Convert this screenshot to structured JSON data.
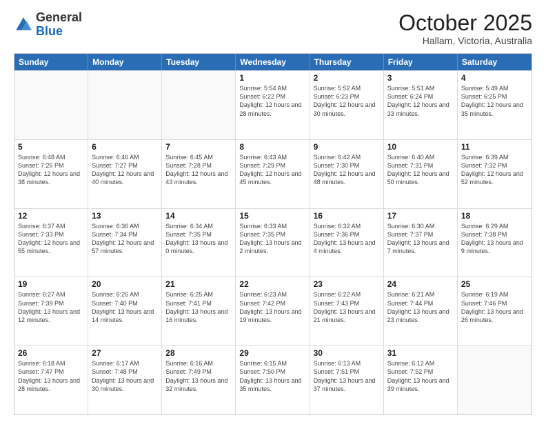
{
  "header": {
    "logo_general": "General",
    "logo_blue": "Blue",
    "month_title": "October 2025",
    "subtitle": "Hallam, Victoria, Australia"
  },
  "calendar": {
    "days_of_week": [
      "Sunday",
      "Monday",
      "Tuesday",
      "Wednesday",
      "Thursday",
      "Friday",
      "Saturday"
    ],
    "rows": [
      [
        {
          "day": "",
          "empty": true
        },
        {
          "day": "",
          "empty": true
        },
        {
          "day": "",
          "empty": true
        },
        {
          "day": "1",
          "sunrise": "Sunrise: 5:54 AM",
          "sunset": "Sunset: 6:22 PM",
          "daylight": "Daylight: 12 hours and 28 minutes."
        },
        {
          "day": "2",
          "sunrise": "Sunrise: 5:52 AM",
          "sunset": "Sunset: 6:23 PM",
          "daylight": "Daylight: 12 hours and 30 minutes."
        },
        {
          "day": "3",
          "sunrise": "Sunrise: 5:51 AM",
          "sunset": "Sunset: 6:24 PM",
          "daylight": "Daylight: 12 hours and 33 minutes."
        },
        {
          "day": "4",
          "sunrise": "Sunrise: 5:49 AM",
          "sunset": "Sunset: 6:25 PM",
          "daylight": "Daylight: 12 hours and 35 minutes."
        }
      ],
      [
        {
          "day": "5",
          "sunrise": "Sunrise: 6:48 AM",
          "sunset": "Sunset: 7:26 PM",
          "daylight": "Daylight: 12 hours and 38 minutes."
        },
        {
          "day": "6",
          "sunrise": "Sunrise: 6:46 AM",
          "sunset": "Sunset: 7:27 PM",
          "daylight": "Daylight: 12 hours and 40 minutes."
        },
        {
          "day": "7",
          "sunrise": "Sunrise: 6:45 AM",
          "sunset": "Sunset: 7:28 PM",
          "daylight": "Daylight: 12 hours and 43 minutes."
        },
        {
          "day": "8",
          "sunrise": "Sunrise: 6:43 AM",
          "sunset": "Sunset: 7:29 PM",
          "daylight": "Daylight: 12 hours and 45 minutes."
        },
        {
          "day": "9",
          "sunrise": "Sunrise: 6:42 AM",
          "sunset": "Sunset: 7:30 PM",
          "daylight": "Daylight: 12 hours and 48 minutes."
        },
        {
          "day": "10",
          "sunrise": "Sunrise: 6:40 AM",
          "sunset": "Sunset: 7:31 PM",
          "daylight": "Daylight: 12 hours and 50 minutes."
        },
        {
          "day": "11",
          "sunrise": "Sunrise: 6:39 AM",
          "sunset": "Sunset: 7:32 PM",
          "daylight": "Daylight: 12 hours and 52 minutes."
        }
      ],
      [
        {
          "day": "12",
          "sunrise": "Sunrise: 6:37 AM",
          "sunset": "Sunset: 7:33 PM",
          "daylight": "Daylight: 12 hours and 55 minutes."
        },
        {
          "day": "13",
          "sunrise": "Sunrise: 6:36 AM",
          "sunset": "Sunset: 7:34 PM",
          "daylight": "Daylight: 12 hours and 57 minutes."
        },
        {
          "day": "14",
          "sunrise": "Sunrise: 6:34 AM",
          "sunset": "Sunset: 7:35 PM",
          "daylight": "Daylight: 13 hours and 0 minutes."
        },
        {
          "day": "15",
          "sunrise": "Sunrise: 6:33 AM",
          "sunset": "Sunset: 7:35 PM",
          "daylight": "Daylight: 13 hours and 2 minutes."
        },
        {
          "day": "16",
          "sunrise": "Sunrise: 6:32 AM",
          "sunset": "Sunset: 7:36 PM",
          "daylight": "Daylight: 13 hours and 4 minutes."
        },
        {
          "day": "17",
          "sunrise": "Sunrise: 6:30 AM",
          "sunset": "Sunset: 7:37 PM",
          "daylight": "Daylight: 13 hours and 7 minutes."
        },
        {
          "day": "18",
          "sunrise": "Sunrise: 6:29 AM",
          "sunset": "Sunset: 7:38 PM",
          "daylight": "Daylight: 13 hours and 9 minutes."
        }
      ],
      [
        {
          "day": "19",
          "sunrise": "Sunrise: 6:27 AM",
          "sunset": "Sunset: 7:39 PM",
          "daylight": "Daylight: 13 hours and 12 minutes."
        },
        {
          "day": "20",
          "sunrise": "Sunrise: 6:26 AM",
          "sunset": "Sunset: 7:40 PM",
          "daylight": "Daylight: 13 hours and 14 minutes."
        },
        {
          "day": "21",
          "sunrise": "Sunrise: 6:25 AM",
          "sunset": "Sunset: 7:41 PM",
          "daylight": "Daylight: 13 hours and 16 minutes."
        },
        {
          "day": "22",
          "sunrise": "Sunrise: 6:23 AM",
          "sunset": "Sunset: 7:42 PM",
          "daylight": "Daylight: 13 hours and 19 minutes."
        },
        {
          "day": "23",
          "sunrise": "Sunrise: 6:22 AM",
          "sunset": "Sunset: 7:43 PM",
          "daylight": "Daylight: 13 hours and 21 minutes."
        },
        {
          "day": "24",
          "sunrise": "Sunrise: 6:21 AM",
          "sunset": "Sunset: 7:44 PM",
          "daylight": "Daylight: 13 hours and 23 minutes."
        },
        {
          "day": "25",
          "sunrise": "Sunrise: 6:19 AM",
          "sunset": "Sunset: 7:46 PM",
          "daylight": "Daylight: 13 hours and 26 minutes."
        }
      ],
      [
        {
          "day": "26",
          "sunrise": "Sunrise: 6:18 AM",
          "sunset": "Sunset: 7:47 PM",
          "daylight": "Daylight: 13 hours and 28 minutes."
        },
        {
          "day": "27",
          "sunrise": "Sunrise: 6:17 AM",
          "sunset": "Sunset: 7:48 PM",
          "daylight": "Daylight: 13 hours and 30 minutes."
        },
        {
          "day": "28",
          "sunrise": "Sunrise: 6:16 AM",
          "sunset": "Sunset: 7:49 PM",
          "daylight": "Daylight: 13 hours and 32 minutes."
        },
        {
          "day": "29",
          "sunrise": "Sunrise: 6:15 AM",
          "sunset": "Sunset: 7:50 PM",
          "daylight": "Daylight: 13 hours and 35 minutes."
        },
        {
          "day": "30",
          "sunrise": "Sunrise: 6:13 AM",
          "sunset": "Sunset: 7:51 PM",
          "daylight": "Daylight: 13 hours and 37 minutes."
        },
        {
          "day": "31",
          "sunrise": "Sunrise: 6:12 AM",
          "sunset": "Sunset: 7:52 PM",
          "daylight": "Daylight: 13 hours and 39 minutes."
        },
        {
          "day": "",
          "empty": true
        }
      ]
    ]
  }
}
